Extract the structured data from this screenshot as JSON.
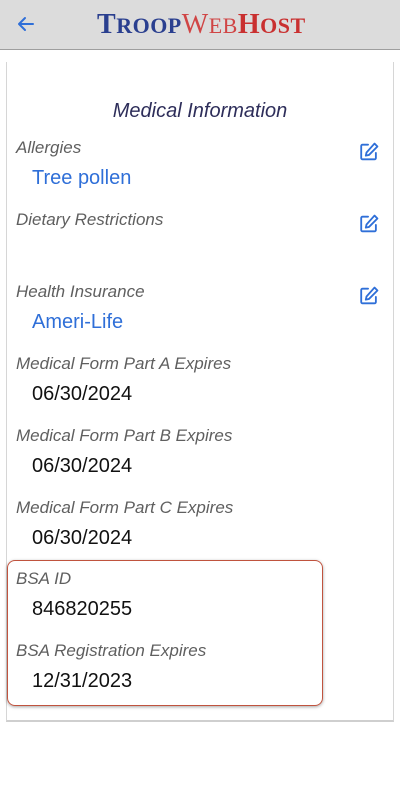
{
  "header": {
    "back_icon": "arrow-left-icon",
    "logo": {
      "troop_T": "T",
      "troop_rest": "ROOP",
      "web_W": "W",
      "web_rest": "EB",
      "host_H": "H",
      "host_rest": "OST"
    },
    "colors": {
      "troop": "#2a3f8f",
      "web": "#d04545",
      "host": "#c93030",
      "back": "#2f6fd8"
    }
  },
  "section": {
    "title": "Medical Information"
  },
  "fields": {
    "allergies": {
      "label": "Allergies",
      "value": "Tree pollen",
      "edit_icon": "edit-icon"
    },
    "dietary": {
      "label": "Dietary Restrictions",
      "value": "",
      "edit_icon": "edit-icon"
    },
    "insurance": {
      "label": "Health Insurance",
      "value": "Ameri-Life",
      "edit_icon": "edit-icon"
    },
    "form_a": {
      "label": "Medical Form Part A Expires",
      "value": "06/30/2024"
    },
    "form_b": {
      "label": "Medical Form Part B Expires",
      "value": "06/30/2024"
    },
    "form_c": {
      "label": "Medical Form Part C Expires",
      "value": "06/30/2024"
    },
    "bsa_id": {
      "label": "BSA ID",
      "value": "846820255"
    },
    "bsa_reg": {
      "label": "BSA Registration Expires",
      "value": "12/31/2023"
    }
  },
  "accent": {
    "link": "#2f6fd8",
    "highlight_border": "#c0533e"
  }
}
